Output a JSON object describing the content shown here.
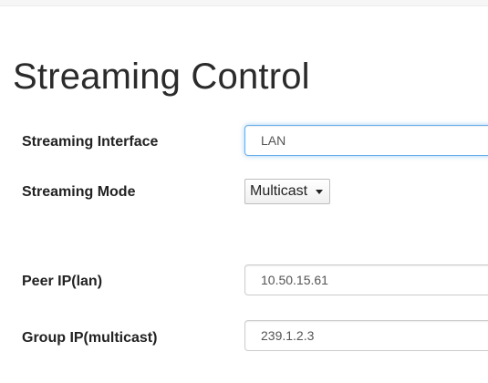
{
  "page": {
    "title": "Streaming Control"
  },
  "form": {
    "streaming_interface": {
      "label": "Streaming Interface",
      "value": "LAN"
    },
    "streaming_mode": {
      "label": "Streaming Mode",
      "selected": "Multicast"
    },
    "peer_ip": {
      "label": "Peer IP(lan)",
      "value": "10.50.15.61"
    },
    "group_ip": {
      "label": "Group IP(multicast)",
      "value": "239.1.2.3"
    }
  },
  "colors": {
    "focus_border": "#66afe9",
    "input_border": "#cccccc",
    "label_text": "#222222"
  },
  "icons": {
    "select_caret": "caret-down-icon"
  }
}
